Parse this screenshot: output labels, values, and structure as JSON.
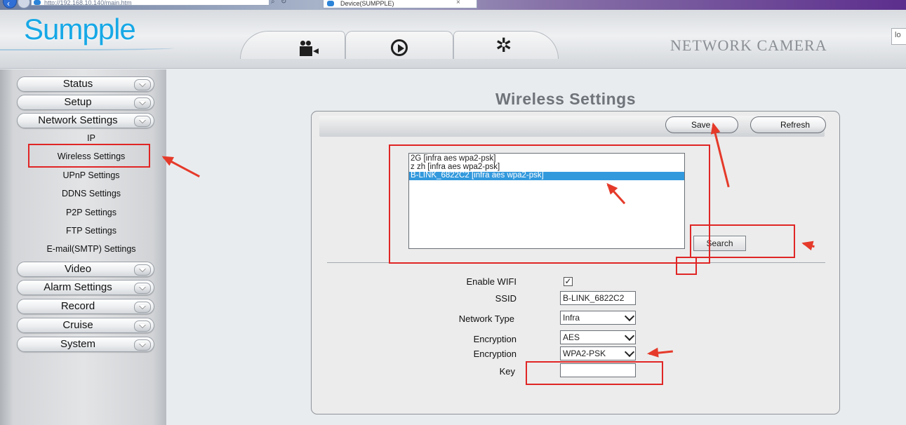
{
  "browser": {
    "address": "http://192.168.10.140/main.htm",
    "tab_title": "Device(SUMPPLE)",
    "close_glyph": "×",
    "search_glyph": "⌕",
    "refresh_glyph": "↻"
  },
  "header": {
    "logo": "Sumpple",
    "title": "NETWORK CAMERA",
    "search_value": "lo",
    "tabs": [
      {
        "icon": "video-camera-icon"
      },
      {
        "icon": "play-icon"
      },
      {
        "icon": "gear-icon",
        "glyph": "✲"
      }
    ]
  },
  "sidebar": {
    "menus": [
      {
        "label": "Status"
      },
      {
        "label": "Setup"
      },
      {
        "label": "Network Settings"
      },
      {
        "label": "Video"
      },
      {
        "label": "Alarm Settings"
      },
      {
        "label": "Record"
      },
      {
        "label": "Cruise"
      },
      {
        "label": "System"
      }
    ],
    "network_items": [
      {
        "label": "IP"
      },
      {
        "label": "Wireless Settings"
      },
      {
        "label": "UPnP Settings"
      },
      {
        "label": "DDNS Settings"
      },
      {
        "label": "P2P Settings"
      },
      {
        "label": "FTP Settings"
      },
      {
        "label": "E-mail(SMTP) Settings"
      }
    ]
  },
  "main": {
    "title": "Wireless Settings",
    "save_label": "Save",
    "refresh_label": "Refresh",
    "search_label": "Search",
    "networks": [
      "2G [infra aes wpa2-psk]",
      "z zh [infra aes wpa2-psk]",
      "B-LINK_6822C2 [infra aes wpa2-psk]"
    ],
    "selected_network": "B-LINK_6822C2 [infra aes wpa2-psk]",
    "form": {
      "enable_wifi_label": "Enable WIFI",
      "enable_wifi_checked": true,
      "check_glyph": "✓",
      "ssid_label": "SSID",
      "ssid_value": "B-LINK_6822C2",
      "network_type_label": "Network Type",
      "network_type_value": "Infra",
      "encryption_label": "Encryption",
      "encryption_value": "AES",
      "encryption2_label": "Encryption",
      "encryption2_value": "WPA2-PSK",
      "key_label": "Key",
      "key_value": ""
    }
  },
  "colors": {
    "accent": "#17a8e6",
    "annotation_red": "#e02525",
    "selection_blue": "#3399dd"
  }
}
